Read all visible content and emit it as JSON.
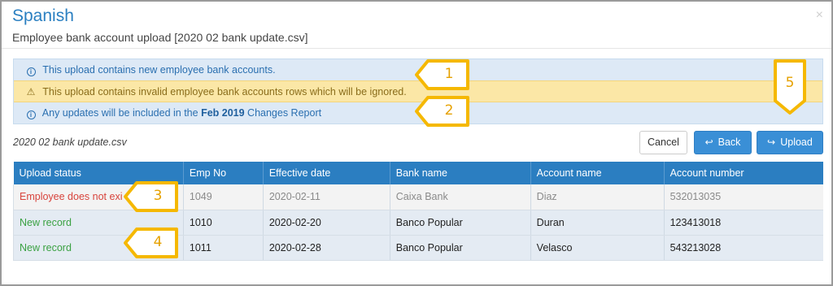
{
  "modal": {
    "title": "Spanish",
    "subtitle": "Employee bank account upload [2020 02 bank update.csv]",
    "close": "×"
  },
  "alerts": {
    "new_accounts": "This upload contains new employee bank accounts.",
    "invalid_rows": "This upload contains invalid employee bank accounts rows which will be ignored.",
    "updates_prefix": "Any updates will be included in the ",
    "updates_period": "Feb 2019",
    "updates_suffix": " Changes Report"
  },
  "file": {
    "name": "2020 02 bank update.csv"
  },
  "buttons": {
    "cancel": "Cancel",
    "back": "Back",
    "upload": "Upload"
  },
  "table": {
    "headers": [
      "Upload status",
      "Emp No",
      "Effective date",
      "Bank name",
      "Account name",
      "Account number"
    ],
    "rows": [
      [
        "Employee does not exi",
        "1049",
        "2020-02-11",
        "Caixa Bank",
        "Diaz",
        "532013035"
      ],
      [
        "New record",
        "1010",
        "2020-02-20",
        "Banco Popular",
        "Duran",
        "123413018"
      ],
      [
        "New record",
        "1011",
        "2020-02-28",
        "Banco Popular",
        "Velasco",
        "543213028"
      ]
    ]
  },
  "callouts": [
    "1",
    "2",
    "3",
    "4",
    "5"
  ],
  "colors": {
    "accent": "#2b7ec1",
    "callout": "#f5b800",
    "error": "#d8443c",
    "success": "#3aa142"
  },
  "icons": {
    "info": "info-circle-icon",
    "warning": "warning-triangle-icon",
    "back": "reply-arrow-icon",
    "upload": "share-arrow-icon"
  }
}
